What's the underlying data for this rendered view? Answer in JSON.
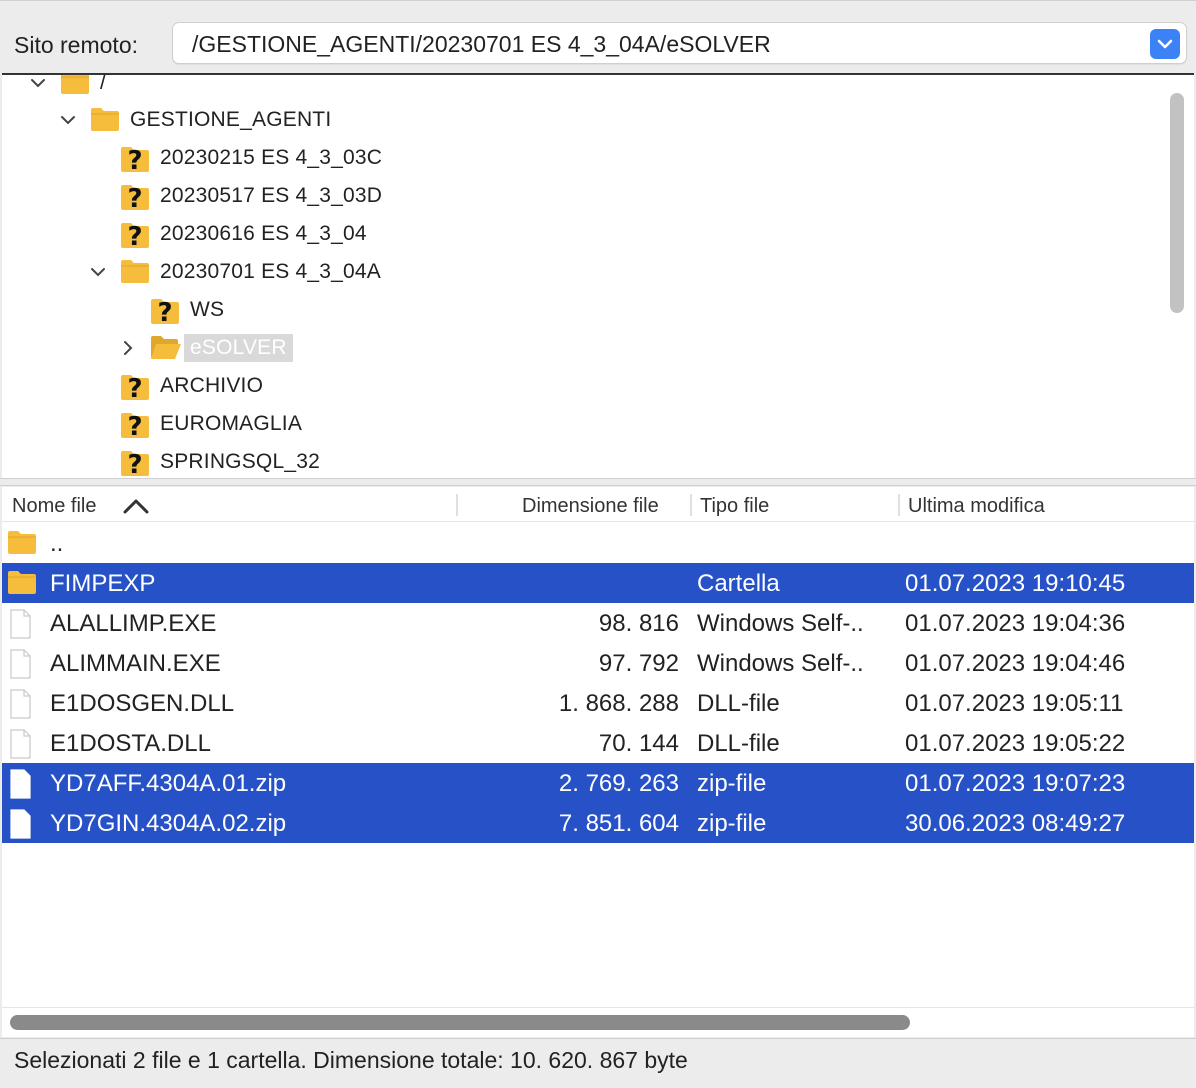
{
  "remote": {
    "label": "Sito remoto:",
    "path": "/GESTIONE_AGENTI/20230701 ES 4_3_04A/eSOLVER"
  },
  "tree": [
    {
      "label": "/",
      "icon": "folder-icon",
      "expanded": true
    },
    {
      "label": "GESTIONE_AGENTI",
      "icon": "folder-icon",
      "expanded": true
    },
    {
      "label": "20230215 ES 4_3_03C",
      "icon": "unknown-folder-icon"
    },
    {
      "label": "20230517 ES 4_3_03D",
      "icon": "unknown-folder-icon"
    },
    {
      "label": "20230616 ES 4_3_04",
      "icon": "unknown-folder-icon"
    },
    {
      "label": "20230701 ES 4_3_04A",
      "icon": "folder-icon",
      "expanded": true
    },
    {
      "label": "WS",
      "icon": "unknown-folder-icon"
    },
    {
      "label": "eSOLVER",
      "icon": "folder-open-icon",
      "selected": true,
      "collapsed": true
    },
    {
      "label": "ARCHIVIO",
      "icon": "unknown-folder-icon"
    },
    {
      "label": "EUROMAGLIA",
      "icon": "unknown-folder-icon"
    },
    {
      "label": "SPRINGSQL_32",
      "icon": "unknown-folder-icon"
    }
  ],
  "columns": {
    "name": "Nome file",
    "size": "Dimensione file",
    "type": "Tipo file",
    "modified": "Ultima modifica"
  },
  "files": [
    {
      "name": "..",
      "size": "",
      "type": "",
      "modified": "",
      "icon": "folder-icon",
      "selected": false
    },
    {
      "name": "FIMPEXP",
      "size": "",
      "type": "Cartella",
      "modified": "01.07.2023 19:10:45",
      "icon": "folder-icon",
      "selected": true
    },
    {
      "name": "ALALLIMP.EXE",
      "size": "98. 816",
      "type": "Windows Self-..",
      "modified": "01.07.2023 19:04:36",
      "icon": "file-icon",
      "selected": false
    },
    {
      "name": "ALIMMAIN.EXE",
      "size": "97. 792",
      "type": "Windows Self-..",
      "modified": "01.07.2023 19:04:46",
      "icon": "file-icon",
      "selected": false
    },
    {
      "name": "E1DOSGEN.DLL",
      "size": "1. 868. 288",
      "type": "DLL-file",
      "modified": "01.07.2023 19:05:11",
      "icon": "file-icon",
      "selected": false
    },
    {
      "name": "E1DOSTA.DLL",
      "size": "70. 144",
      "type": "DLL-file",
      "modified": "01.07.2023 19:05:22",
      "icon": "file-icon",
      "selected": false
    },
    {
      "name": "YD7AFF.4304A.01.zip",
      "size": "2. 769. 263",
      "type": "zip-file",
      "modified": "01.07.2023 19:07:23",
      "icon": "file-icon",
      "selected": true
    },
    {
      "name": "YD7GIN.4304A.02.zip",
      "size": "7. 851. 604",
      "type": "zip-file",
      "modified": "30.06.2023 08:49:27",
      "icon": "file-icon",
      "selected": true
    }
  ],
  "status": "Selezionati 2 file e 1 cartella. Dimensione totale: 10. 620. 867 byte",
  "colors": {
    "selection": "#2651c7",
    "folder": "#f5bd3b",
    "accent": "#3b82f6"
  }
}
